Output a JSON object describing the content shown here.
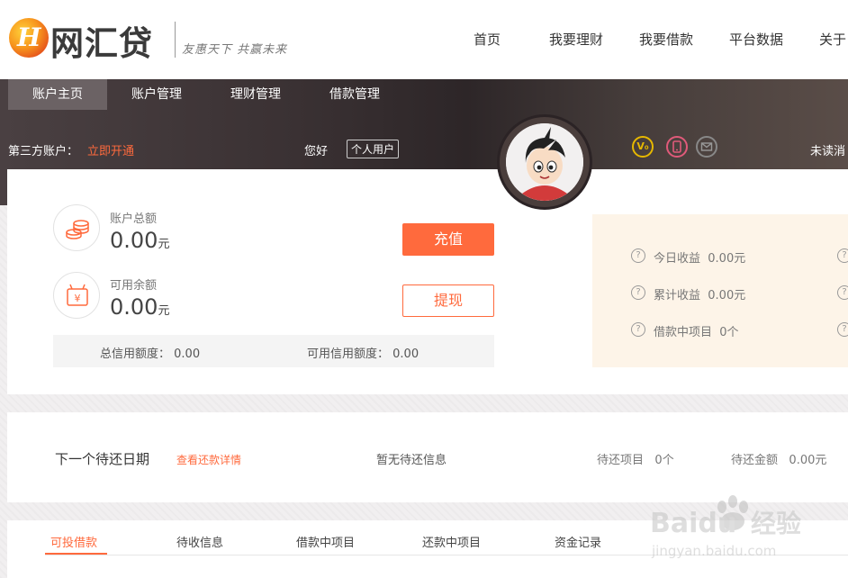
{
  "brand": {
    "logo_letter": "H",
    "name": "网汇贷",
    "slogan": "友惠天下 共赢未来"
  },
  "nav": [
    "首页",
    "我要理财",
    "我要借款",
    "平台数据",
    "关于"
  ],
  "account_tabs": [
    "账户主页",
    "账户管理",
    "理财管理",
    "借款管理"
  ],
  "account_bar": {
    "third_party_label": "第三方账户：",
    "third_party_link": "立即开通",
    "greeting": "您好",
    "user_type": "个人用户",
    "unread": "未读消",
    "vip_icon_text": "V₀"
  },
  "balances": {
    "total_label": "账户总额",
    "total_value": "0.00",
    "total_unit": "元",
    "available_label": "可用余额",
    "available_value": "0.00",
    "available_unit": "元",
    "recharge_button": "充值",
    "withdraw_button": "提现"
  },
  "credit": {
    "total_label": "总信用额度：",
    "total_value": "0.00",
    "available_label": "可用信用额度：",
    "available_value": "0.00"
  },
  "stats": [
    {
      "label": "今日收益",
      "value": "0.00元"
    },
    {
      "label": "累计收益",
      "value": "0.00元"
    },
    {
      "label": "借款中项目",
      "value": "0个"
    }
  ],
  "repay": {
    "title": "下一个待还日期",
    "link": "查看还款详情",
    "none": "暂无待还信息",
    "pending_items_label": "待还项目",
    "pending_items_value": "0个",
    "pending_amount_label": "待还金额",
    "pending_amount_value": "0.00元"
  },
  "bottom_tabs": [
    "可投借款",
    "待收信息",
    "借款中项目",
    "还款中项目",
    "资金记录"
  ],
  "watermark": {
    "brand": "Baidu",
    "cn": "经验",
    "url": "jingyan.baidu.com"
  },
  "colors": {
    "accent": "#ff6a3d",
    "banner": "#3a3133",
    "stats_bg": "#fdf4e8",
    "vip": "#e6b800",
    "phone": "#e05a7a",
    "mail": "#888888"
  }
}
